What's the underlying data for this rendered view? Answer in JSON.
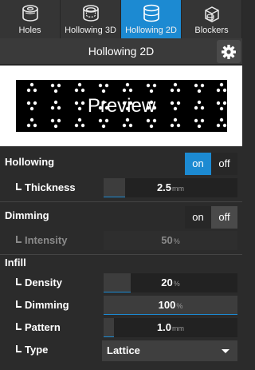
{
  "tabs": [
    {
      "label": "Holes",
      "icon": "holes-icon"
    },
    {
      "label": "Hollowing 3D",
      "icon": "hollowing-3d-icon"
    },
    {
      "label": "Hollowing 2D",
      "icon": "hollowing-2d-icon",
      "active": true
    },
    {
      "label": "Blockers",
      "icon": "blockers-icon"
    }
  ],
  "header": {
    "title": "Hollowing 2D",
    "settings_icon": "gear-icon"
  },
  "preview": {
    "text": "Preview"
  },
  "hollowing": {
    "label": "Hollowing",
    "toggle": {
      "on": "on",
      "off": "off",
      "selected": "on"
    },
    "thickness": {
      "label": "Thickness",
      "value": "2.5",
      "unit": "mm",
      "fill_fraction": 0.16
    }
  },
  "dimming": {
    "label": "Dimming",
    "toggle": {
      "on": "on",
      "off": "off",
      "selected": "off"
    },
    "intensity": {
      "label": "Intensity",
      "value": "50",
      "unit": "%",
      "fill_fraction": 0.0,
      "disabled": true
    }
  },
  "infill": {
    "label": "Infill",
    "density": {
      "label": "Density",
      "value": "20",
      "unit": "%",
      "fill_fraction": 0.2
    },
    "dimming": {
      "label": "Dimming",
      "value": "100",
      "unit": "%",
      "fill_fraction": 1.0
    },
    "pattern": {
      "label": "Pattern",
      "value": "1.0",
      "unit": "mm",
      "fill_fraction": 0.08
    },
    "type": {
      "label": "Type",
      "value": "Lattice"
    }
  },
  "colors": {
    "accent": "#1c8ad2",
    "background": "#2b2b2b"
  }
}
